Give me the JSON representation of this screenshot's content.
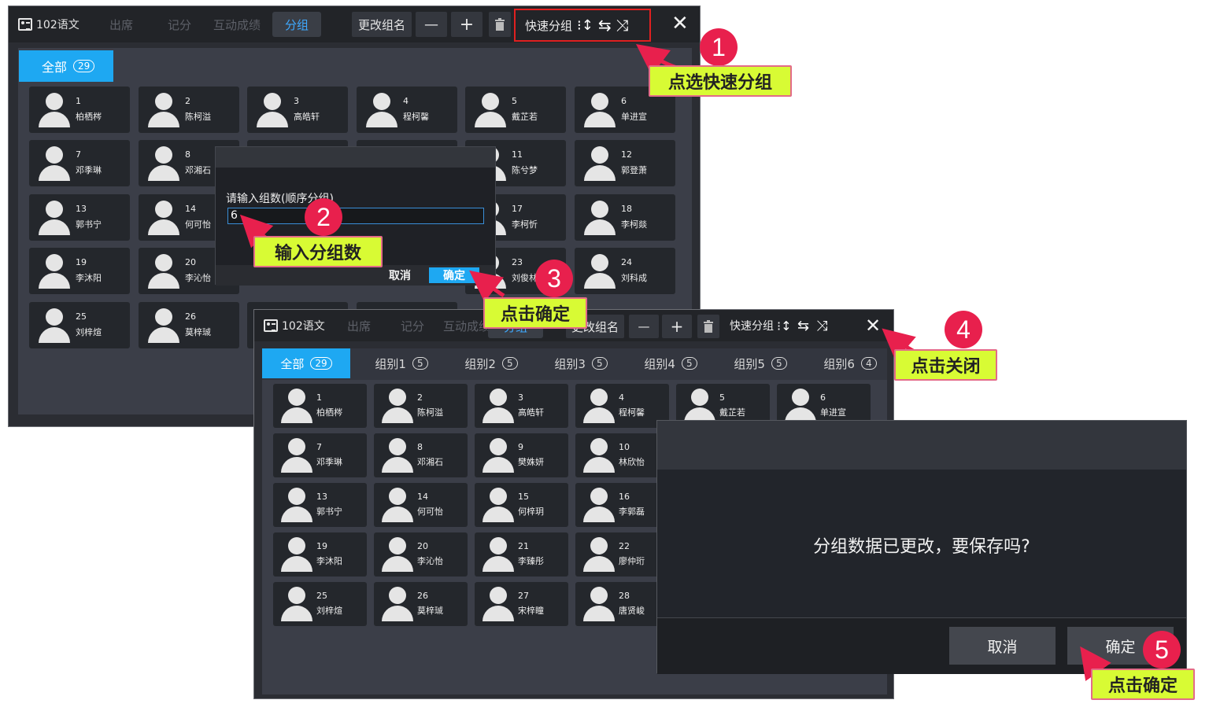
{
  "window1": {
    "title": "102语文",
    "tabs": [
      "出席",
      "记分",
      "互动成绩",
      "分组"
    ],
    "rename_label": "更改组名",
    "minus_label": "—",
    "plus_label": "+",
    "quick_group_label": "快速分组",
    "all_tab": {
      "label": "全部",
      "count": "29"
    },
    "students": [
      {
        "num": "1",
        "name": "柏栖梣"
      },
      {
        "num": "2",
        "name": "陈柯溢"
      },
      {
        "num": "3",
        "name": "高皓轩"
      },
      {
        "num": "4",
        "name": "程柯馨"
      },
      {
        "num": "5",
        "name": "戴芷若"
      },
      {
        "num": "6",
        "name": "单进宣"
      },
      {
        "num": "7",
        "name": "邓季琳"
      },
      {
        "num": "8",
        "name": "邓湘石"
      },
      {
        "num": "11",
        "name": "陈兮梦"
      },
      {
        "num": "12",
        "name": "郭登萧"
      },
      {
        "num": "13",
        "name": "郭书宁"
      },
      {
        "num": "14",
        "name": "何可怡"
      },
      {
        "num": "17",
        "name": "李柯忻"
      },
      {
        "num": "18",
        "name": "李柯燚"
      },
      {
        "num": "19",
        "name": "李沐阳"
      },
      {
        "num": "20",
        "name": "李沁怡"
      },
      {
        "num": "23",
        "name": "刘俊林"
      },
      {
        "num": "24",
        "name": "刘科成"
      },
      {
        "num": "25",
        "name": "刘梓煊"
      },
      {
        "num": "26",
        "name": "莫梓珹"
      }
    ],
    "dialog": {
      "prompt": "请输入组数(顺序分组)",
      "value": "6",
      "cancel": "取消",
      "ok": "确定"
    }
  },
  "window2": {
    "title": "102语文",
    "tabs": [
      "出席",
      "记分",
      "互动成绩",
      "分组"
    ],
    "rename_label": "更改组名",
    "minus_label": "—",
    "plus_label": "+",
    "quick_group_label": "快速分组",
    "group_tabs": [
      {
        "label": "全部",
        "count": "29"
      },
      {
        "label": "组别1",
        "count": "5"
      },
      {
        "label": "组别2",
        "count": "5"
      },
      {
        "label": "组别3",
        "count": "5"
      },
      {
        "label": "组别4",
        "count": "5"
      },
      {
        "label": "组别5",
        "count": "5"
      },
      {
        "label": "组别6",
        "count": "4"
      }
    ],
    "students": [
      {
        "num": "1",
        "name": "柏栖梣"
      },
      {
        "num": "2",
        "name": "陈柯溢"
      },
      {
        "num": "3",
        "name": "高皓轩"
      },
      {
        "num": "4",
        "name": "程柯馨"
      },
      {
        "num": "5",
        "name": "戴芷若"
      },
      {
        "num": "6",
        "name": "单进宣"
      },
      {
        "num": "7",
        "name": "邓季琳"
      },
      {
        "num": "8",
        "name": "邓湘石"
      },
      {
        "num": "9",
        "name": "樊姝妍"
      },
      {
        "num": "10",
        "name": "林欣怡"
      },
      {
        "num": "13",
        "name": "郭书宁"
      },
      {
        "num": "14",
        "name": "何可怡"
      },
      {
        "num": "15",
        "name": "何梓玥"
      },
      {
        "num": "16",
        "name": "李郭磊"
      },
      {
        "num": "19",
        "name": "李沐阳"
      },
      {
        "num": "20",
        "name": "李沁怡"
      },
      {
        "num": "21",
        "name": "李臻彤"
      },
      {
        "num": "22",
        "name": "廖仲珩"
      },
      {
        "num": "25",
        "name": "刘梓煊"
      },
      {
        "num": "26",
        "name": "莫梓珹"
      },
      {
        "num": "27",
        "name": "宋梓瞳"
      },
      {
        "num": "28",
        "name": "唐贤峻"
      }
    ],
    "save_dialog": {
      "message": "分组数据已更改，要保存吗?",
      "cancel": "取消",
      "ok": "确定"
    }
  },
  "annotations": {
    "step1": {
      "num": "1",
      "label": "点选快速分组"
    },
    "step2": {
      "num": "2",
      "label": "输入分组数"
    },
    "step3": {
      "num": "3",
      "label": "点击确定"
    },
    "step4": {
      "num": "4",
      "label": "点击关闭"
    },
    "step5": {
      "num": "5",
      "label": "点击确定"
    }
  },
  "colors": {
    "accent": "#1ea8f2",
    "highlight_box": "#d8fb34",
    "step_circle": "#e8204d",
    "frame_red": "#e02020"
  }
}
